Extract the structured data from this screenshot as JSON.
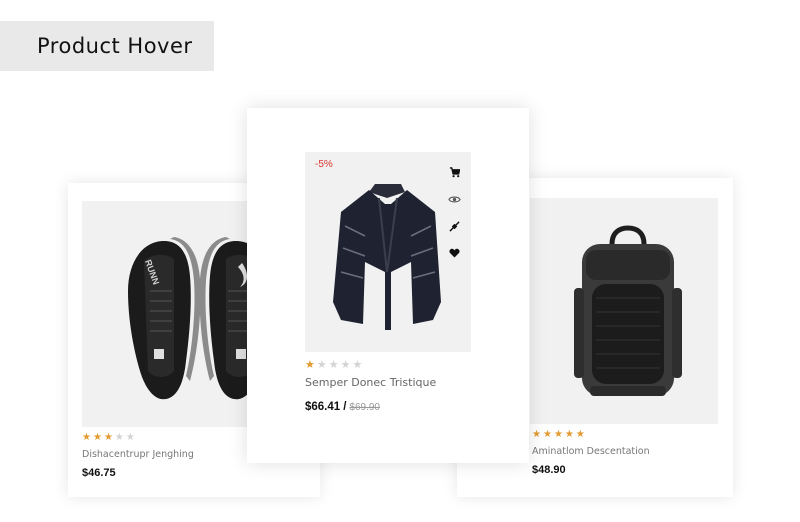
{
  "header": {
    "title": "Product Hover"
  },
  "products": [
    {
      "name": "Dishacentrupr Jenghing",
      "price": "$46.75",
      "rating": 3,
      "max_rating": 5,
      "image_icon": "sneakers-icon"
    },
    {
      "name": "Semper Donec Tristique",
      "price": "$66.41",
      "price_separator": "/",
      "old_price": "$69.90",
      "discount": "-5%",
      "rating": 1,
      "max_rating": 5,
      "image_icon": "poncho-icon",
      "hover_actions": [
        "cart-icon",
        "eye-icon",
        "compare-icon",
        "heart-icon"
      ]
    },
    {
      "name": "Aminatlom Descentation",
      "price": "$48.90",
      "rating": 5,
      "max_rating": 5,
      "image_icon": "backpack-icon"
    }
  ],
  "colors": {
    "star_on": "#e39a2f",
    "star_off": "#d3d3d3",
    "discount": "#d9332b",
    "badge_bg": "#e9e9e9"
  }
}
